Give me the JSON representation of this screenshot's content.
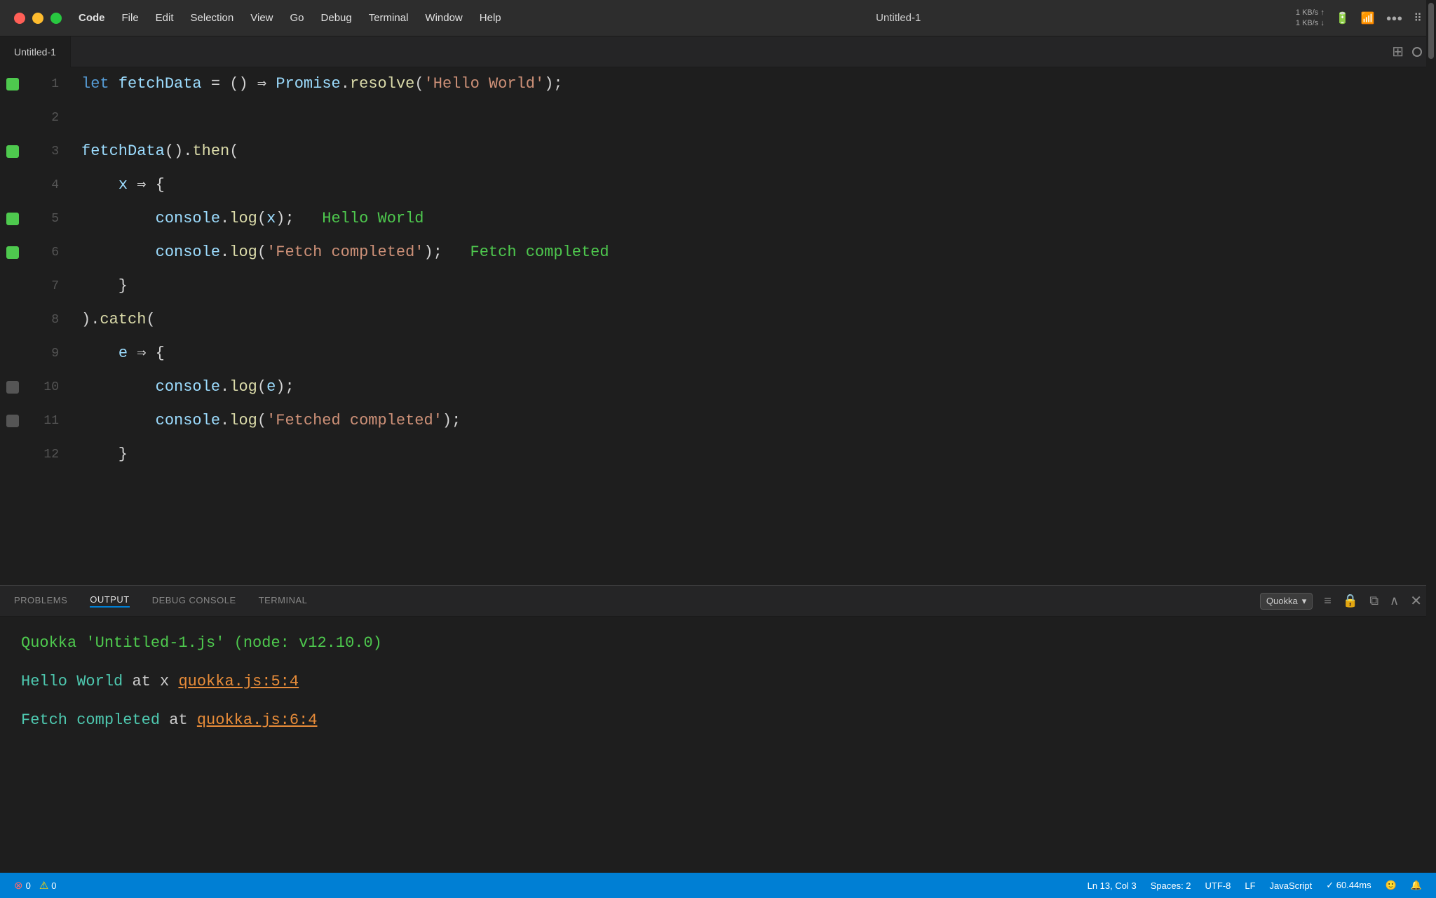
{
  "titlebar": {
    "traffic_lights": [
      "red",
      "yellow",
      "green"
    ],
    "menu_items": [
      "Code",
      "File",
      "Edit",
      "Selection",
      "View",
      "Go",
      "Debug",
      "Terminal",
      "Window",
      "Help"
    ],
    "title": "Untitled-1",
    "status_right": "1 KB/s ↑\n1 KB/s ↓"
  },
  "tab_bar": {
    "tab_label": "Untitled-1",
    "icons": [
      "split-icon",
      "circle-icon"
    ]
  },
  "editor": {
    "lines": [
      {
        "number": "1",
        "gutter": "green",
        "tokens": [
          {
            "type": "kw",
            "text": "let "
          },
          {
            "type": "var",
            "text": "fetchData"
          },
          {
            "type": "plain",
            "text": " = "
          },
          {
            "type": "punct",
            "text": "() "
          },
          {
            "type": "arrow",
            "text": "⇒ "
          },
          {
            "type": "var",
            "text": "Promise"
          },
          {
            "type": "plain",
            "text": "."
          },
          {
            "type": "method",
            "text": "resolve"
          },
          {
            "type": "plain",
            "text": "("
          },
          {
            "type": "str",
            "text": "'Hello World'"
          },
          {
            "type": "plain",
            "text": ");"
          }
        ]
      },
      {
        "number": "2",
        "gutter": "empty",
        "tokens": []
      },
      {
        "number": "3",
        "gutter": "green",
        "tokens": [
          {
            "type": "var",
            "text": "fetchData"
          },
          {
            "type": "plain",
            "text": "()."
          },
          {
            "type": "method",
            "text": "then"
          },
          {
            "type": "plain",
            "text": "("
          }
        ]
      },
      {
        "number": "4",
        "gutter": "empty",
        "tokens": [
          {
            "type": "plain",
            "text": "    "
          },
          {
            "type": "var",
            "text": "x"
          },
          {
            "type": "plain",
            "text": " "
          },
          {
            "type": "arrow",
            "text": "⇒"
          },
          {
            "type": "plain",
            "text": " {"
          }
        ]
      },
      {
        "number": "5",
        "gutter": "green",
        "tokens": [
          {
            "type": "plain",
            "text": "        "
          },
          {
            "type": "var",
            "text": "console"
          },
          {
            "type": "plain",
            "text": "."
          },
          {
            "type": "method",
            "text": "log"
          },
          {
            "type": "plain",
            "text": "("
          },
          {
            "type": "var",
            "text": "x"
          },
          {
            "type": "plain",
            "text": ");"
          },
          {
            "type": "output-inline",
            "text": "   Hello World"
          }
        ]
      },
      {
        "number": "6",
        "gutter": "green",
        "tokens": [
          {
            "type": "plain",
            "text": "        "
          },
          {
            "type": "var",
            "text": "console"
          },
          {
            "type": "plain",
            "text": "."
          },
          {
            "type": "method",
            "text": "log"
          },
          {
            "type": "plain",
            "text": "("
          },
          {
            "type": "str",
            "text": "'Fetch completed'"
          },
          {
            "type": "plain",
            "text": ");"
          },
          {
            "type": "output-inline",
            "text": "   Fetch completed"
          }
        ]
      },
      {
        "number": "7",
        "gutter": "empty",
        "tokens": [
          {
            "type": "plain",
            "text": "    }"
          }
        ]
      },
      {
        "number": "8",
        "gutter": "empty",
        "tokens": [
          {
            "type": "plain",
            "text": ")."
          },
          {
            "type": "method",
            "text": "catch"
          },
          {
            "type": "plain",
            "text": "("
          }
        ]
      },
      {
        "number": "9",
        "gutter": "empty",
        "tokens": [
          {
            "type": "plain",
            "text": "    "
          },
          {
            "type": "var",
            "text": "e"
          },
          {
            "type": "plain",
            "text": " "
          },
          {
            "type": "arrow",
            "text": "⇒"
          },
          {
            "type": "plain",
            "text": " {"
          }
        ]
      },
      {
        "number": "10",
        "gutter": "gray",
        "tokens": [
          {
            "type": "plain",
            "text": "        "
          },
          {
            "type": "var",
            "text": "console"
          },
          {
            "type": "plain",
            "text": "."
          },
          {
            "type": "method",
            "text": "log"
          },
          {
            "type": "plain",
            "text": "("
          },
          {
            "type": "var",
            "text": "e"
          },
          {
            "type": "plain",
            "text": ");"
          }
        ]
      },
      {
        "number": "11",
        "gutter": "gray",
        "tokens": [
          {
            "type": "plain",
            "text": "        "
          },
          {
            "type": "var",
            "text": "console"
          },
          {
            "type": "plain",
            "text": "."
          },
          {
            "type": "method",
            "text": "log"
          },
          {
            "type": "plain",
            "text": "("
          },
          {
            "type": "str",
            "text": "'Fetched completed'"
          },
          {
            "type": "plain",
            "text": ");"
          }
        ]
      },
      {
        "number": "12",
        "gutter": "empty",
        "tokens": [
          {
            "type": "plain",
            "text": "    }"
          }
        ]
      }
    ]
  },
  "panel": {
    "tabs": [
      {
        "label": "PROBLEMS",
        "active": false
      },
      {
        "label": "OUTPUT",
        "active": true
      },
      {
        "label": "DEBUG CONSOLE",
        "active": false
      },
      {
        "label": "TERMINAL",
        "active": false
      }
    ],
    "select_value": "Quokka",
    "output_lines": [
      {
        "type": "quokka-header",
        "text": "Quokka 'Untitled-1.js' (node: v12.10.0)"
      },
      {
        "type": "hello-world",
        "prefix": "Hello World",
        "middle": " at x ",
        "link": "quokka.js:5:4"
      },
      {
        "type": "fetch-completed",
        "prefix": "Fetch completed",
        "middle": " at ",
        "link": "quokka.js:6:4"
      }
    ]
  },
  "statusbar": {
    "errors": "0",
    "warnings": "0",
    "ln_col": "Ln 13, Col 3",
    "spaces": "Spaces: 2",
    "encoding": "UTF-8",
    "line_ending": "LF",
    "language": "JavaScript",
    "quokka_time": "✓ 60.44ms"
  }
}
